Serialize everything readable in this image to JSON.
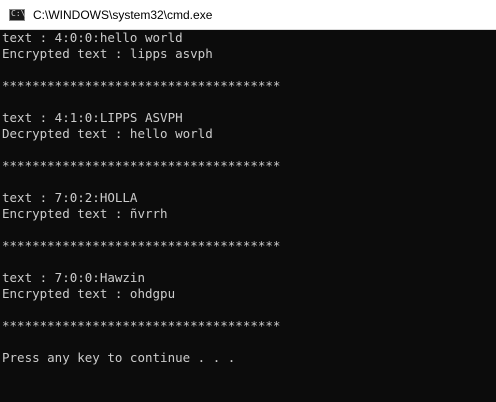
{
  "window": {
    "title": "C:\\WINDOWS\\system32\\cmd.exe",
    "icon": "cmd-icon",
    "icon_text": "C:\\"
  },
  "console": {
    "lines": [
      "text : 4:0:0:hello world",
      "Encrypted text : lipps asvph",
      "*************************************",
      "text : 4:1:0:LIPPS ASVPH",
      "Decrypted text : hello world",
      "*************************************",
      "text : 7:0:2:HOLLA",
      "Encrypted text : ñvrrh",
      "*************************************",
      "text : 7:0:0:Hawzin",
      "Encrypted text : ohdgpu",
      "*************************************",
      "Press any key to continue . . ."
    ]
  }
}
